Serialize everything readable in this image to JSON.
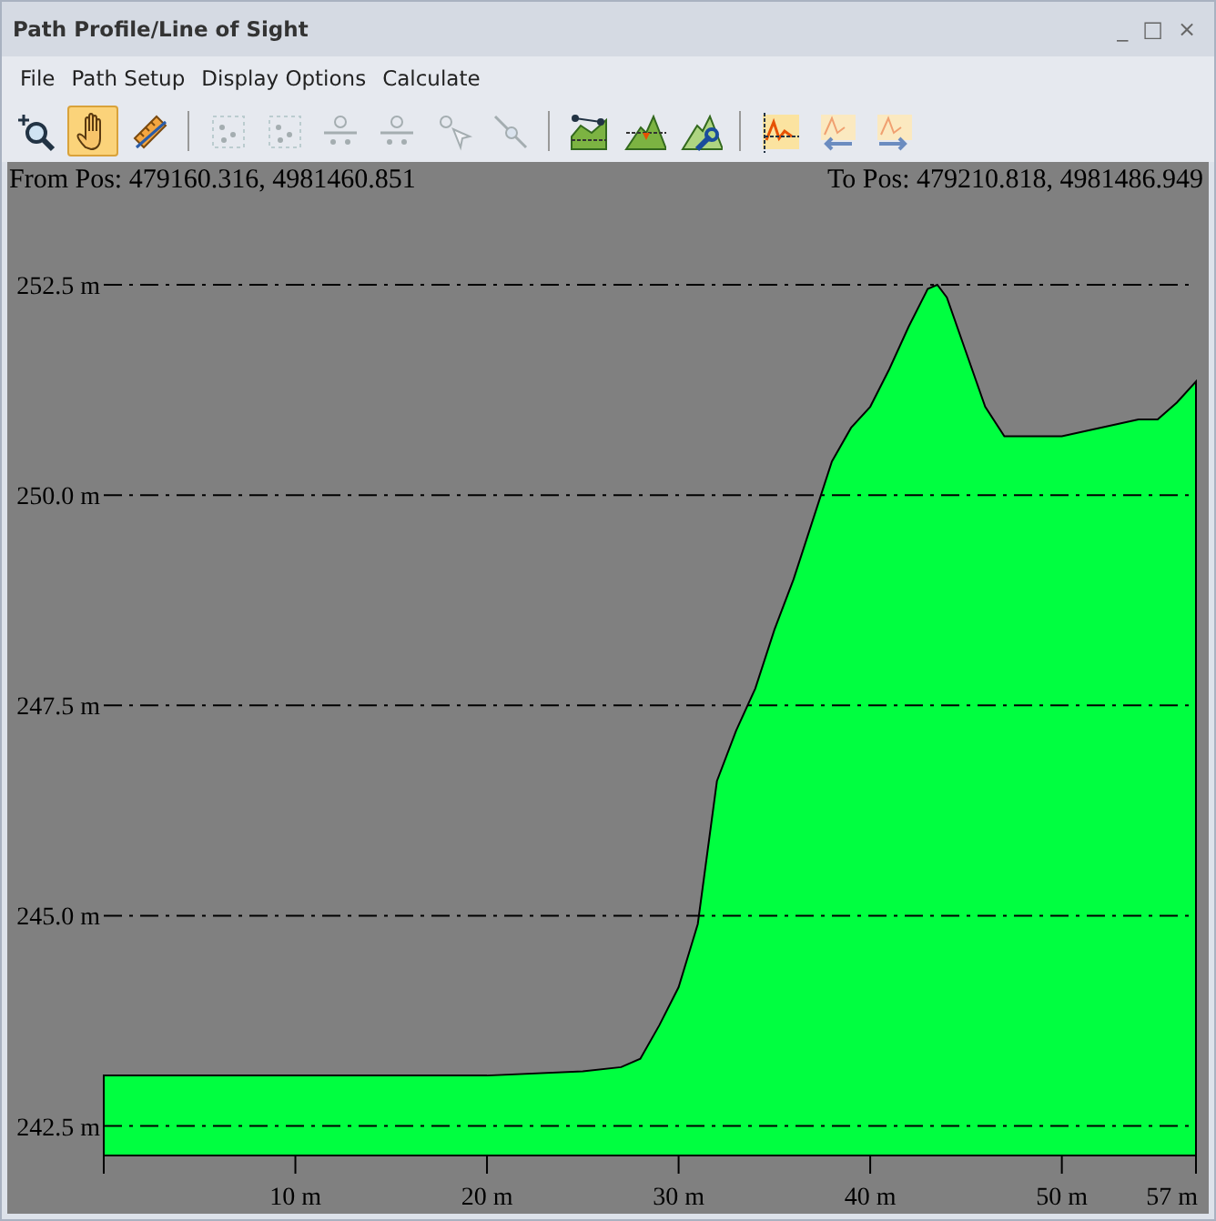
{
  "window": {
    "title": "Path Profile/Line of Sight",
    "controls": [
      "_",
      "□",
      "×"
    ]
  },
  "menu": [
    "File",
    "Path Setup",
    "Display Options",
    "Calculate"
  ],
  "toolbar": [
    {
      "kind": "zoom",
      "selected": false,
      "disabled": false
    },
    {
      "kind": "hand",
      "selected": true,
      "disabled": false
    },
    {
      "kind": "ruler",
      "selected": false,
      "disabled": false
    },
    {
      "kind": "separator"
    },
    {
      "kind": "points",
      "selected": false,
      "disabled": true
    },
    {
      "kind": "points",
      "selected": false,
      "disabled": true
    },
    {
      "kind": "split",
      "selected": false,
      "disabled": true
    },
    {
      "kind": "split",
      "selected": false,
      "disabled": true
    },
    {
      "kind": "pointer",
      "selected": false,
      "disabled": true
    },
    {
      "kind": "line",
      "selected": false,
      "disabled": true
    },
    {
      "kind": "separator"
    },
    {
      "kind": "terrain",
      "selected": false,
      "disabled": false
    },
    {
      "kind": "mountain",
      "selected": false,
      "disabled": false
    },
    {
      "kind": "wrench",
      "selected": false,
      "disabled": false
    },
    {
      "kind": "separator"
    },
    {
      "kind": "profile",
      "selected": false,
      "disabled": false
    },
    {
      "kind": "back",
      "selected": false,
      "disabled": false
    },
    {
      "kind": "forward",
      "selected": false,
      "disabled": false
    }
  ],
  "profile": {
    "from": "From Pos: 479160.316, 4981460.851",
    "to": "To Pos: 479210.818, 4981486.949",
    "chart_data": {
      "type": "area",
      "x": [
        0,
        10,
        20,
        25,
        27,
        28,
        29,
        30,
        31,
        32,
        33,
        34,
        35,
        36,
        37,
        38,
        39,
        40,
        41,
        42,
        43,
        43.5,
        44,
        45,
        46,
        47,
        48,
        50,
        52,
        54,
        55,
        56,
        57
      ],
      "series": [
        {
          "color": "#00ff40",
          "values": [
            243.1,
            243.1,
            243.1,
            243.15,
            243.2,
            243.3,
            243.7,
            244.15,
            244.9,
            246.6,
            247.2,
            247.7,
            248.4,
            249.0,
            249.7,
            250.4,
            250.8,
            251.05,
            251.5,
            252.0,
            252.45,
            252.5,
            252.35,
            251.7,
            251.05,
            250.7,
            250.7,
            250.7,
            250.8,
            250.9,
            250.9,
            251.1,
            251.35
          ]
        }
      ],
      "xlim": [
        0,
        57
      ],
      "ylim": [
        242.5,
        252.5
      ],
      "grid": true,
      "xticks": [
        {
          "value": 10,
          "label": "10 m"
        },
        {
          "value": 20,
          "label": "20 m"
        },
        {
          "value": 30,
          "label": "30 m"
        },
        {
          "value": 40,
          "label": "40 m"
        },
        {
          "value": 50,
          "label": "50 m"
        },
        {
          "value": 57,
          "label": "57 m"
        }
      ],
      "yticks": [
        {
          "value": 242.5,
          "label": "242.5 m"
        },
        {
          "value": 245,
          "label": "245.0 m"
        },
        {
          "value": 247.5,
          "label": "247.5 m"
        },
        {
          "value": 250,
          "label": "250.0 m"
        },
        {
          "value": 252.5,
          "label": "252.5 m"
        }
      ]
    }
  }
}
